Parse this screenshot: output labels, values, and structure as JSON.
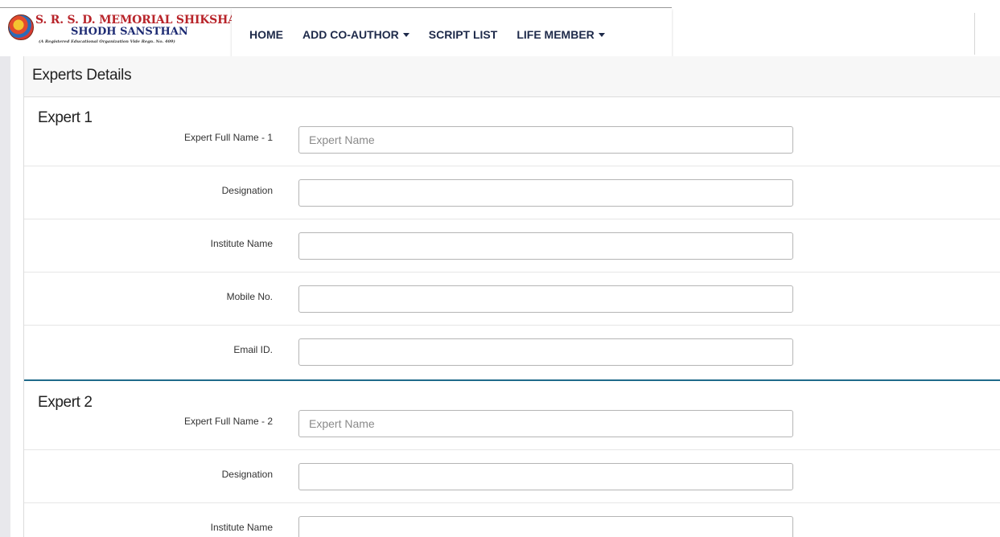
{
  "logo": {
    "line1": "S. R. S. D. MEMORIAL SHIKSHA",
    "line2": "SHODH SANSTHAN",
    "line3": "(A Registered Educational Organization Vide Regn. No. 409)"
  },
  "nav": {
    "items": [
      {
        "label": "HOME",
        "has_dropdown": false
      },
      {
        "label": "ADD CO-AUTHOR",
        "has_dropdown": true
      },
      {
        "label": "SCRIPT LIST",
        "has_dropdown": false
      },
      {
        "label": "LIFE MEMBER",
        "has_dropdown": true
      }
    ]
  },
  "card": {
    "title": "Experts Details"
  },
  "experts": [
    {
      "title": "Expert 1",
      "fields": [
        {
          "label": "Expert Full Name - 1",
          "placeholder": "Expert Name",
          "value": ""
        },
        {
          "label": "Designation",
          "placeholder": "",
          "value": ""
        },
        {
          "label": "Institute Name",
          "placeholder": "",
          "value": ""
        },
        {
          "label": "Mobile No.",
          "placeholder": "",
          "value": ""
        },
        {
          "label": "Email ID.",
          "placeholder": "",
          "value": ""
        }
      ]
    },
    {
      "title": "Expert 2",
      "fields": [
        {
          "label": "Expert Full Name - 2",
          "placeholder": "Expert Name",
          "value": ""
        },
        {
          "label": "Designation",
          "placeholder": "",
          "value": ""
        },
        {
          "label": "Institute Name",
          "placeholder": "",
          "value": ""
        }
      ]
    }
  ],
  "colors": {
    "nav_text": "#1e2a4a",
    "logo_red": "#b8242a",
    "logo_blue": "#1d2b73",
    "section_divider": "#1f6a8a"
  }
}
